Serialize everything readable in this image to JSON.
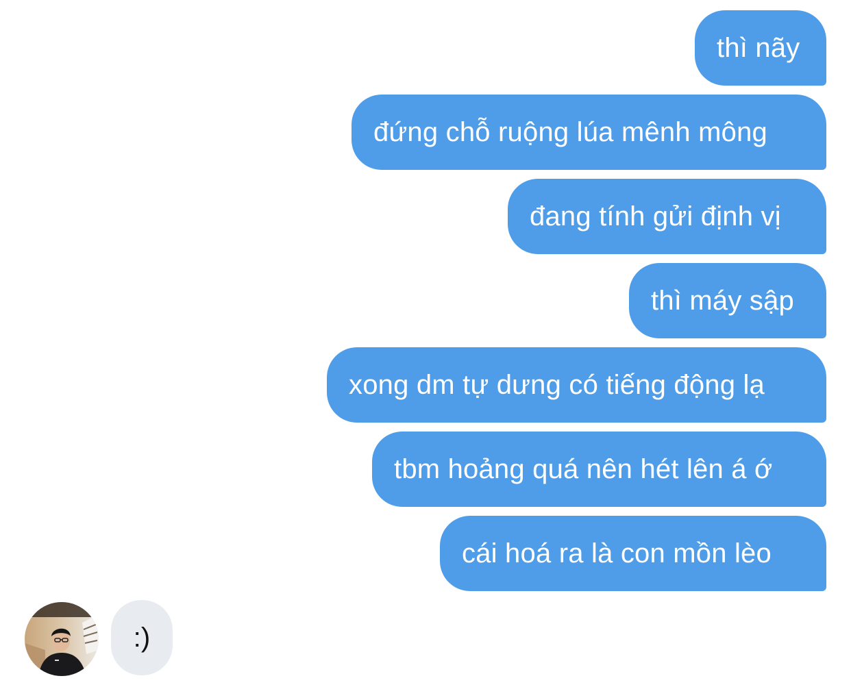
{
  "conversation": {
    "outgoing": [
      {
        "text": "thì nãy"
      },
      {
        "text": "đứng chỗ ruộng lúa mênh mông"
      },
      {
        "text": "đang tính gửi định vị"
      },
      {
        "text": "thì máy sập"
      },
      {
        "text": "xong dm tự dưng có tiếng động lạ"
      },
      {
        "text": "tbm hoảng quá nên hét lên á ớ"
      },
      {
        "text": "cái hoá ra là con mồn lèo"
      }
    ],
    "incoming": [
      {
        "text": ":)"
      }
    ]
  },
  "colors": {
    "outgoing_bubble": "#4f9de8",
    "incoming_bubble": "#e8ecf1",
    "outgoing_text": "#ffffff",
    "incoming_text": "#111111"
  },
  "avatar": {
    "icon": "user-photo-avatar"
  }
}
